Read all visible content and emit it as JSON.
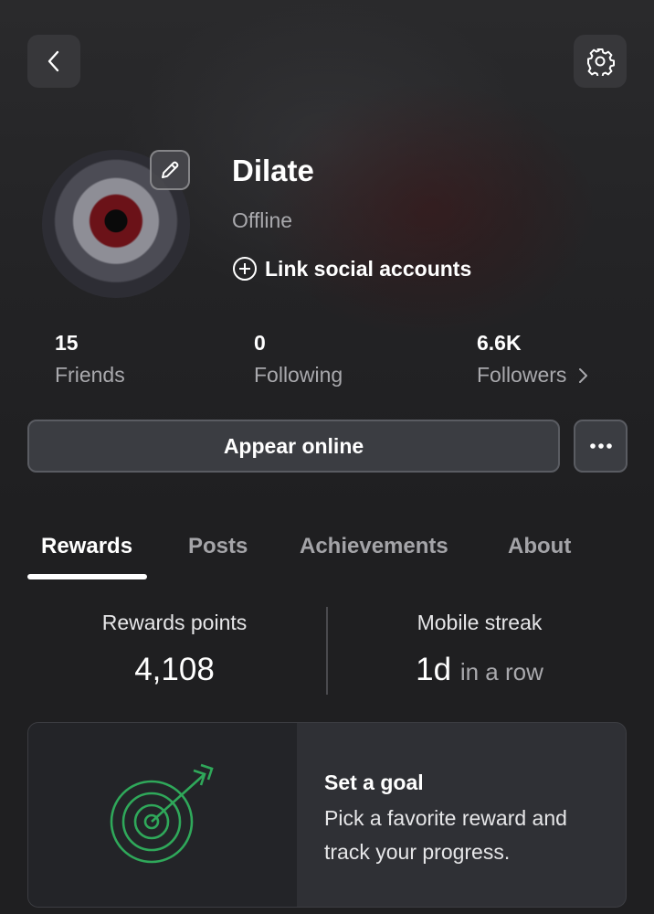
{
  "profile": {
    "username": "Dilate",
    "status": "Offline",
    "link_social_label": "Link social accounts"
  },
  "stats": {
    "friends": {
      "count": "15",
      "label": "Friends"
    },
    "following": {
      "count": "0",
      "label": "Following"
    },
    "followers": {
      "count": "6.6K",
      "label": "Followers"
    }
  },
  "actions": {
    "appear_online_label": "Appear online"
  },
  "tabs": [
    {
      "label": "Rewards",
      "active": true
    },
    {
      "label": "Posts",
      "active": false
    },
    {
      "label": "Achievements",
      "active": false
    },
    {
      "label": "About",
      "active": false
    }
  ],
  "rewards": {
    "points_label": "Rewards points",
    "points_value": "4,108",
    "streak_label": "Mobile streak",
    "streak_value": "1d",
    "streak_suffix": "in a row"
  },
  "goal_card": {
    "title": "Set a goal",
    "description": "Pick a favorite reward and track your progress."
  },
  "icons": {
    "back": "chevron-left-icon",
    "settings": "gear-icon",
    "edit": "pencil-icon",
    "add": "plus-circle-icon",
    "more": "ellipsis-icon",
    "goal": "target-icon"
  },
  "colors": {
    "background": "#1f1f21",
    "button": "#3b3d42",
    "accent_green": "#2fa85a",
    "muted_text": "#a9a9ad"
  }
}
